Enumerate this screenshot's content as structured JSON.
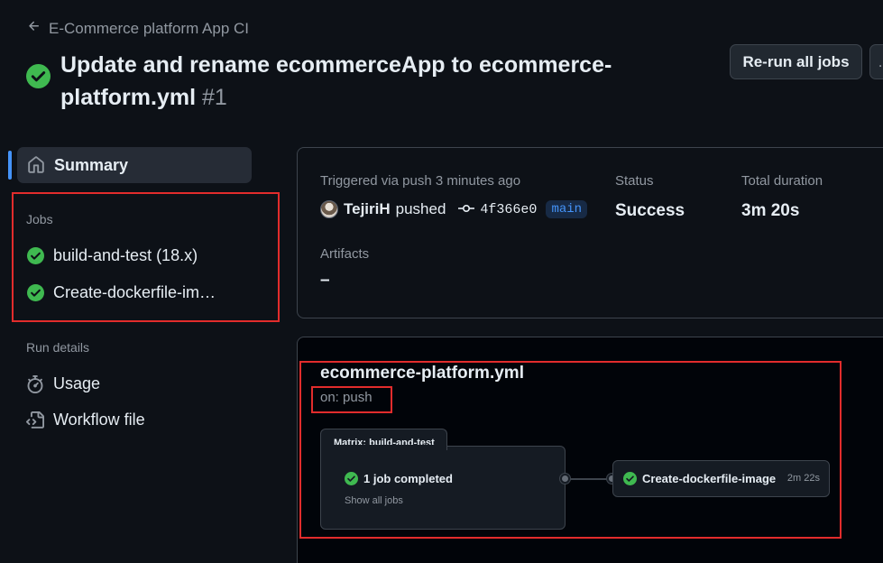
{
  "header": {
    "back_label": "E-Commerce platform App CI",
    "title": "Update and rename ecommerceApp to ecommerce-platform.yml",
    "run_number": "#1",
    "rerun_label": "Re-run all jobs",
    "more_label": "…"
  },
  "sidebar": {
    "summary_label": "Summary",
    "jobs_heading": "Jobs",
    "jobs": [
      {
        "label": "build-and-test (18.x)",
        "status": "success"
      },
      {
        "label": "Create-dockerfile-im…",
        "status": "success"
      }
    ],
    "run_details_heading": "Run details",
    "run_details": [
      {
        "label": "Usage",
        "icon": "stopwatch-icon"
      },
      {
        "label": "Workflow file",
        "icon": "file-code-icon"
      }
    ]
  },
  "summary": {
    "trigger_text": "Triggered via push 3 minutes ago",
    "actor": "TejiriH",
    "action": "pushed",
    "commit_sha": "4f366e0",
    "branch": "main",
    "status_label": "Status",
    "status_value": "Success",
    "duration_label": "Total duration",
    "duration_value": "3m 20s",
    "artifacts_label": "Artifacts",
    "artifacts_value": "–"
  },
  "graph": {
    "workflow_name": "ecommerce-platform.yml",
    "trigger": "on: push",
    "matrix_label": "Matrix: build-and-test",
    "matrix_status": "1 job completed",
    "show_all": "Show all jobs",
    "job_name": "Create-dockerfile-image",
    "job_duration": "2m 22s"
  },
  "colors": {
    "success": "#3fb950",
    "accent": "#4493f8",
    "annotation_red": "#e22c2c",
    "background": "#0d1117"
  }
}
